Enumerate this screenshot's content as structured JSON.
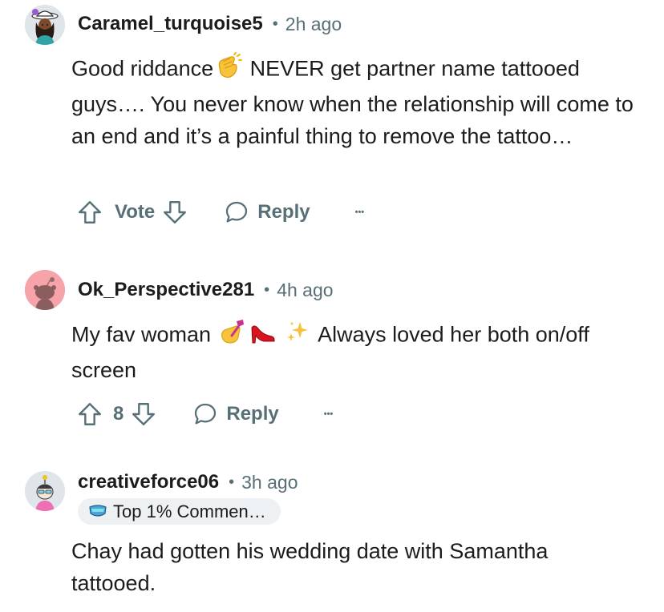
{
  "comments": [
    {
      "username": "Caramel_turquoise5",
      "separator": "•",
      "time": "2h ago",
      "text_before_emoji": "Good riddance",
      "text_after_emoji": " NEVER get partner name tattooed guys…. You never know when the relationship will come to an end and it’s a painful thing to remove the tattoo…",
      "vote_label": "Vote",
      "reply_label": "Reply",
      "more_label": "•••"
    },
    {
      "username": "Ok_Perspective281",
      "separator": "•",
      "time": "4h ago",
      "text_before_emoji": "My fav woman",
      "text_after_emoji": " Always loved her both on/off screen",
      "vote_label": "8",
      "reply_label": "Reply",
      "more_label": "•••"
    },
    {
      "username": "creativeforce06",
      "separator": "•",
      "time": "3h ago",
      "badge_label": "Top 1% Commen…",
      "text": "Chay had gotten his wedding date with Samantha tattooed."
    }
  ],
  "colors": {
    "text_primary": "#1c1c1c",
    "text_secondary": "#576f76",
    "badge_bg": "#eef1f3",
    "avatar2_bg": "#f6a3a9"
  }
}
